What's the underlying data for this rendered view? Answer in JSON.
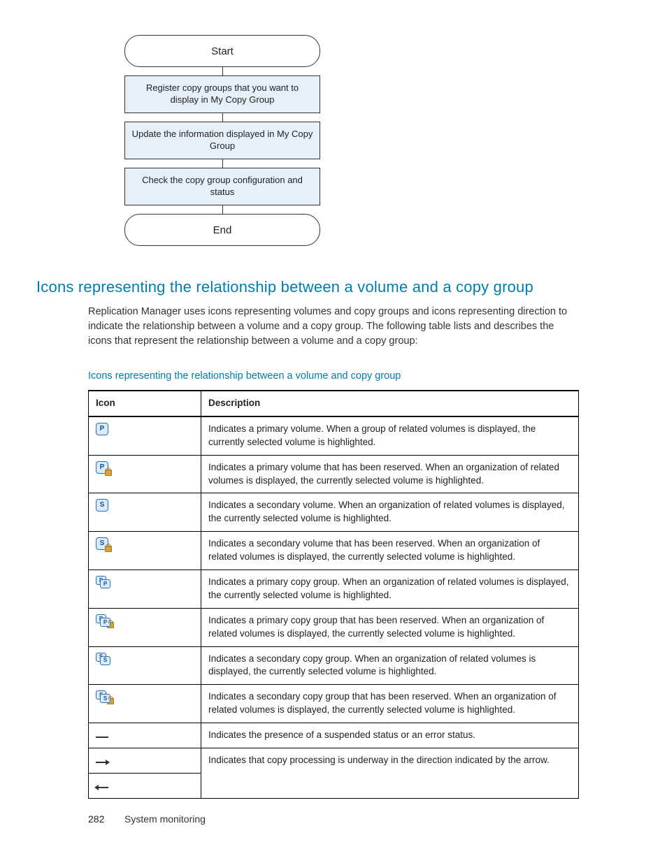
{
  "flow": {
    "start": "Start",
    "step1": "Register copy groups that you want to display in My Copy Group",
    "step2": "Update the information displayed in My Copy Group",
    "step3": "Check the copy group configuration and status",
    "end": "End"
  },
  "heading": "Icons representing the relationship between a volume and a copy group",
  "paragraph": "Replication Manager uses icons representing volumes and copy groups and icons representing direction to indicate the relationship between a volume and a copy group. The following table lists and describes the icons that represent the relationship between a volume and a copy group:",
  "table_caption": "Icons representing the relationship between a volume and copy group",
  "table": {
    "head_icon": "Icon",
    "head_desc": "Description",
    "rows": [
      {
        "icon": "primary-volume-icon",
        "desc": "Indicates a primary volume. When a group of related volumes is displayed, the currently selected volume is highlighted."
      },
      {
        "icon": "primary-volume-reserved-icon",
        "desc": "Indicates a primary volume that has been reserved. When an organization of related volumes is displayed, the currently selected volume is highlighted."
      },
      {
        "icon": "secondary-volume-icon",
        "desc": "Indicates a secondary volume. When an organization of related volumes is displayed, the currently selected volume is highlighted."
      },
      {
        "icon": "secondary-volume-reserved-icon",
        "desc": "Indicates a secondary volume that has been reserved. When an organization of related volumes is displayed, the currently selected volume is highlighted."
      },
      {
        "icon": "primary-copy-group-icon",
        "desc": "Indicates a primary copy group. When an organization of related volumes is displayed, the currently selected volume is highlighted."
      },
      {
        "icon": "primary-copy-group-reserved-icon",
        "desc": "Indicates a primary copy group that has been reserved. When an organization of related volumes is displayed, the currently selected volume is highlighted."
      },
      {
        "icon": "secondary-copy-group-icon",
        "desc": "Indicates a secondary copy group. When an organization of related volumes is displayed, the currently selected volume is highlighted."
      },
      {
        "icon": "secondary-copy-group-reserved-icon",
        "desc": "Indicates a secondary copy group that has been reserved. When an organization of related volumes is displayed, the currently selected volume is highlighted."
      },
      {
        "icon": "suspended-error-icon",
        "desc": "Indicates the presence of a suspended status or an error status."
      },
      {
        "icon": "arrow-right-icon",
        "desc": "Indicates that copy processing is underway in the direction indicated by the arrow."
      },
      {
        "icon": "arrow-left-icon",
        "desc": ""
      }
    ]
  },
  "footer": {
    "page": "282",
    "section": "System monitoring"
  }
}
